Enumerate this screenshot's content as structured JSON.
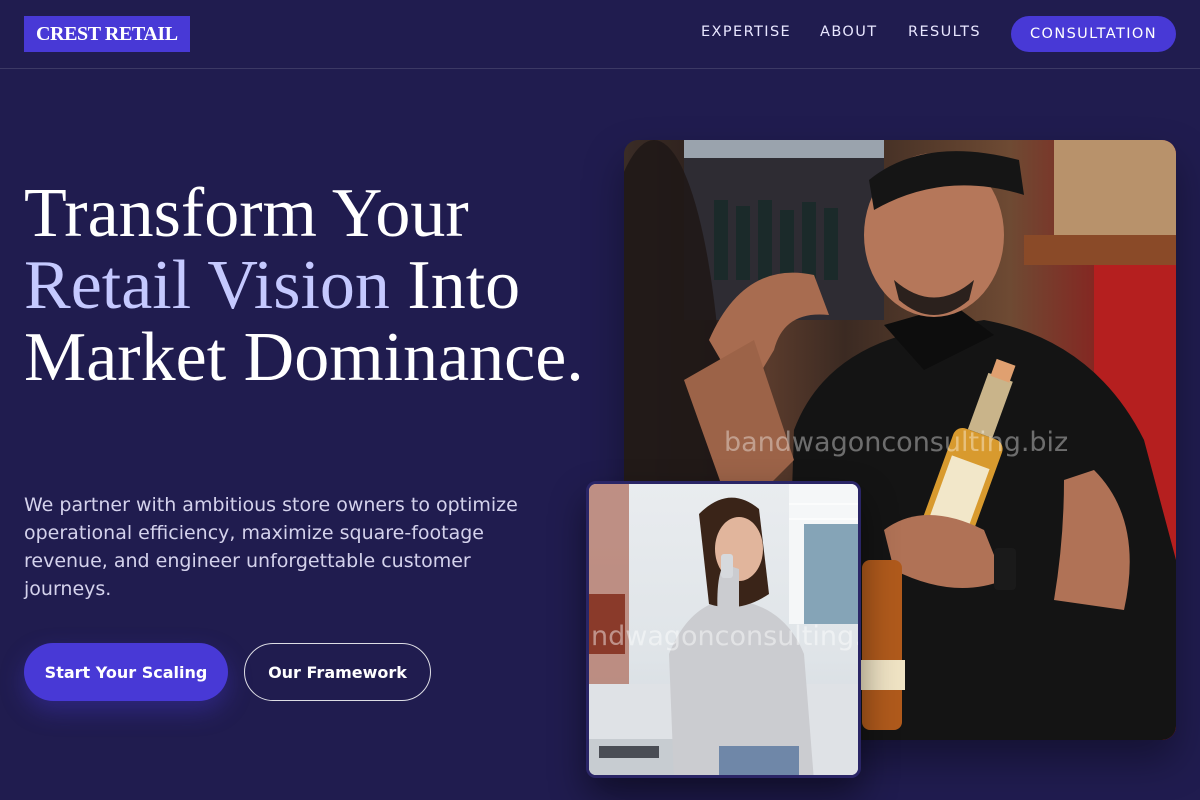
{
  "brand": {
    "logo_text": "CREST RETAIL"
  },
  "nav": {
    "links": [
      "EXPERTISE",
      "ABOUT",
      "RESULTS"
    ],
    "cta_label": "CONSULTATION"
  },
  "hero": {
    "headline_part1": "Transform Your",
    "headline_accent": "Retail Vision",
    "headline_part2": "Into Market Dominance.",
    "subtext": "We partner with ambitious store owners to optimize operational efficiency, maximize square-footage revenue, and engineer unforgettable customer journeys.",
    "primary_button": "Start Your Scaling",
    "secondary_button": "Our Framework"
  },
  "images": {
    "main_watermark": "bandwagonconsulting.biz",
    "inset_watermark": "ndwagonconsulting.b"
  },
  "colors": {
    "background": "#201c4f",
    "accent": "#4839d6",
    "headline_accent": "#c5c9ff"
  }
}
